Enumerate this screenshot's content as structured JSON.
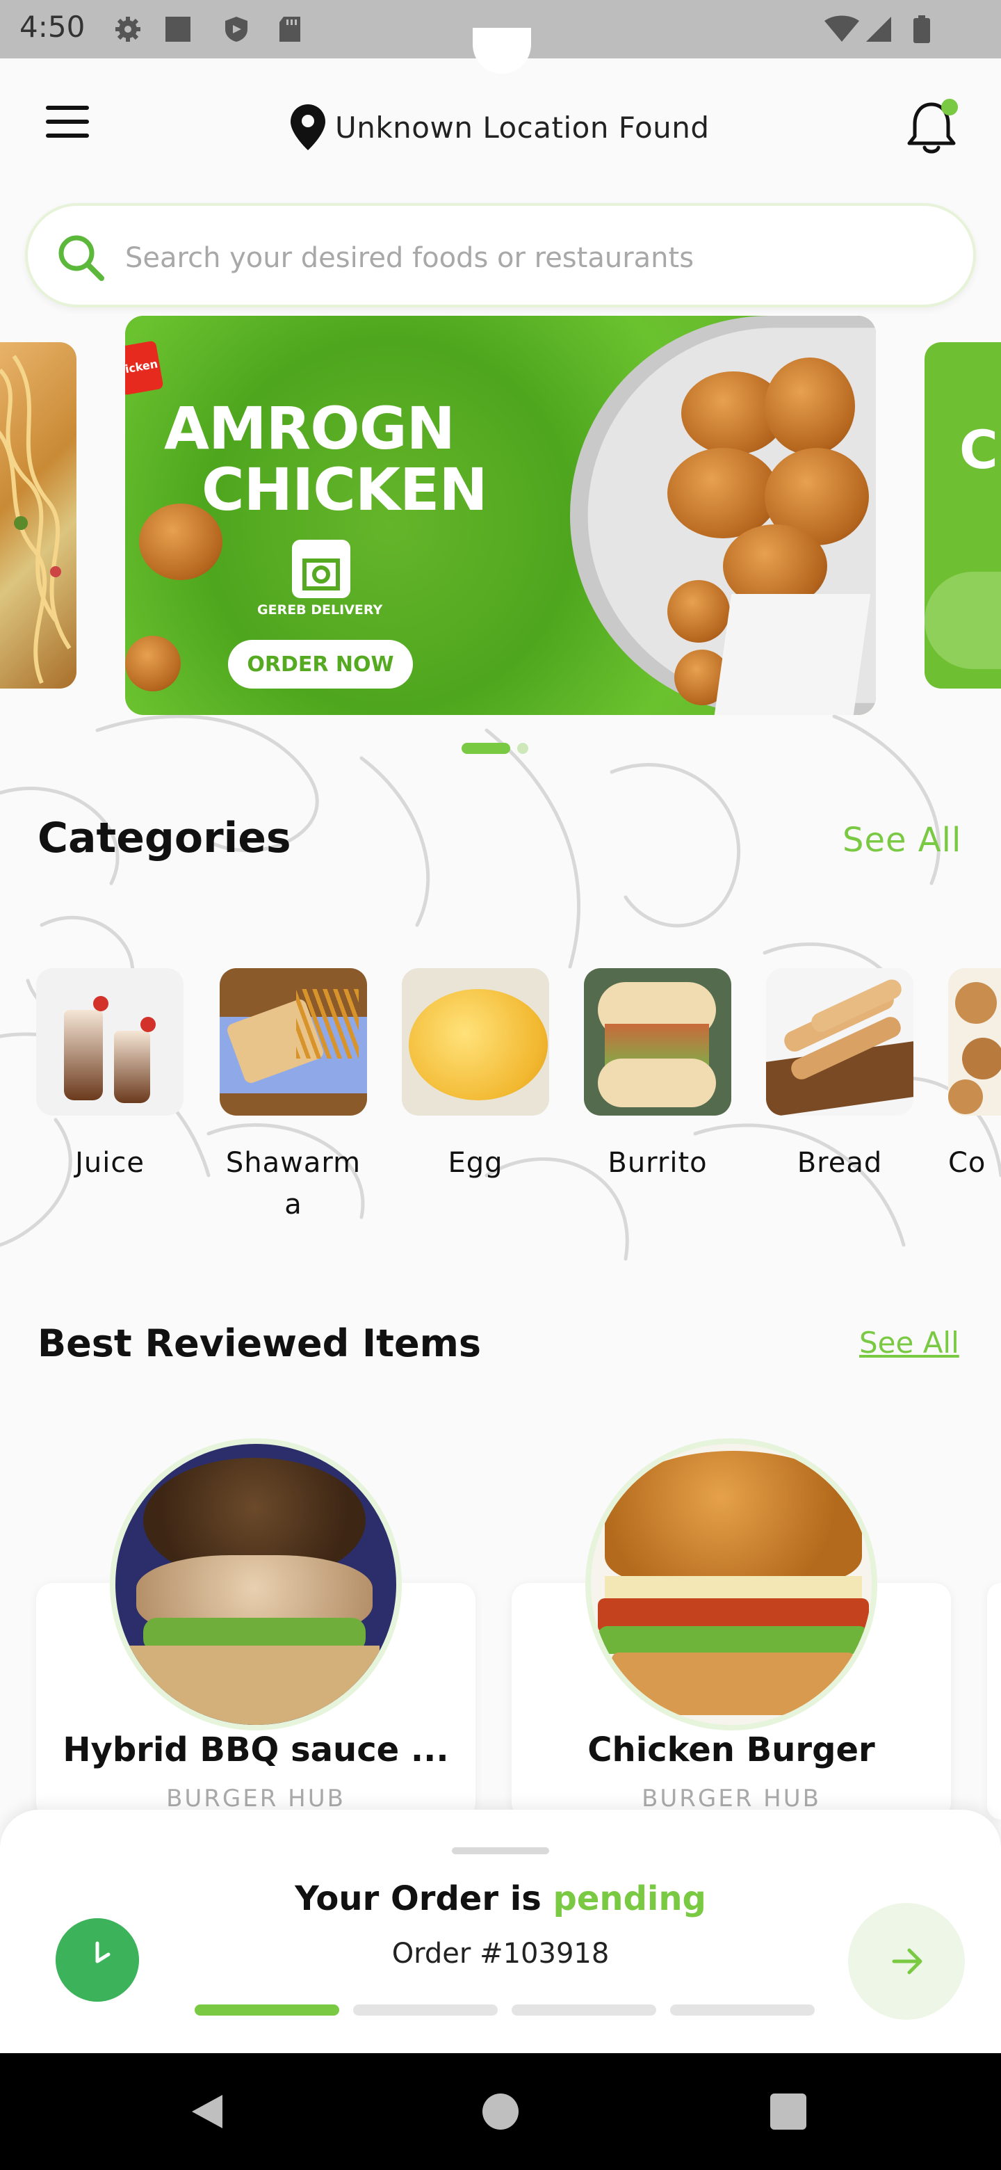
{
  "status_bar": {
    "time": "4:50"
  },
  "header": {
    "location": "Unknown Location Found"
  },
  "search": {
    "placeholder": "Search your desired foods or restaurants"
  },
  "banner": {
    "title_line1": "AMROGN",
    "title_line2": "CHICKEN",
    "brand": "GEREB DELIVERY",
    "cta": "ORDER NOW",
    "right_peek": "Cl",
    "stamp": "icken",
    "active_index": 0,
    "count": 2
  },
  "categories": {
    "title": "Categories",
    "see_all": "See All",
    "items": [
      {
        "label": "Juice"
      },
      {
        "label": "Shawarma"
      },
      {
        "label": "Egg"
      },
      {
        "label": "Burrito"
      },
      {
        "label": "Bread"
      },
      {
        "label": "Co"
      }
    ]
  },
  "best_reviewed": {
    "title": "Best Reviewed Items",
    "see_all": "See All",
    "items": [
      {
        "name": "Hybrid BBQ sauce ...",
        "restaurant": "BURGER HUB"
      },
      {
        "name": "Chicken Burger",
        "restaurant": "BURGER HUB"
      }
    ]
  },
  "order_sheet": {
    "title_prefix": "Your Order is",
    "status": "pending",
    "order_number": "Order #103918",
    "progress_steps": 4,
    "progress_done": 1
  },
  "colors": {
    "accent": "#7ac943",
    "clock": "#3cb25a",
    "banner_green": "#55aa22"
  }
}
